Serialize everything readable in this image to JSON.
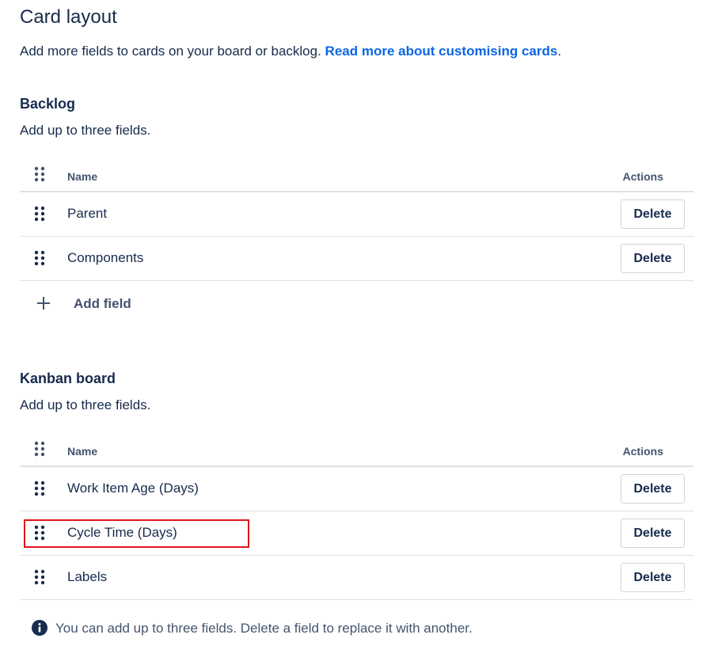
{
  "page": {
    "title": "Card layout",
    "subtitle_text": "Add more fields to cards on your board or backlog. ",
    "subtitle_link": "Read more about customising cards",
    "subtitle_end": "."
  },
  "backlog": {
    "heading": "Backlog",
    "description": "Add up to three fields.",
    "columns": {
      "name": "Name",
      "actions": "Actions"
    },
    "rows": [
      {
        "name": "Parent",
        "action": "Delete"
      },
      {
        "name": "Components",
        "action": "Delete"
      }
    ],
    "add_field_label": "Add field"
  },
  "kanban": {
    "heading": "Kanban board",
    "description": "Add up to three fields.",
    "columns": {
      "name": "Name",
      "actions": "Actions"
    },
    "rows": [
      {
        "name": "Work Item Age (Days)",
        "action": "Delete"
      },
      {
        "name": "Cycle Time (Days)",
        "action": "Delete"
      },
      {
        "name": "Labels",
        "action": "Delete"
      }
    ],
    "info_message": "You can add up to three fields. Delete a field to replace it with another."
  },
  "icons": {
    "drag_handle": "drag-handle-icon",
    "add": "plus-icon",
    "info": "info-icon"
  },
  "colors": {
    "text": "#172b4d",
    "link": "#0c66e4",
    "border": "#dfe1e6",
    "highlight": "#e0161e"
  }
}
